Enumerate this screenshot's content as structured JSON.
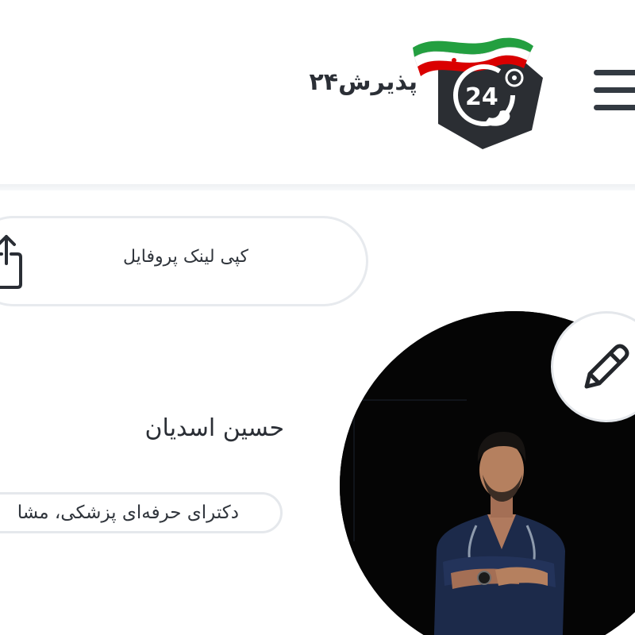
{
  "header": {
    "brand_name": "پذیرش۲۴",
    "logo_number": "24",
    "menu_icon": "hamburger-menu-icon"
  },
  "profile": {
    "copy_link_label": "کپی لینک پروفایل",
    "share_icon": "share-icon",
    "edit_icon": "pencil-icon",
    "doctor_name": "حسین اسدیان",
    "specialty": "دکترای حرفه‌ای پزشکی، مشا"
  },
  "colors": {
    "text": "#2a2e35",
    "border": "#e7eaee",
    "logo_dark": "#2b2e33",
    "flag_green": "#239f40",
    "flag_red": "#da0000",
    "photo_bg": "#050505"
  }
}
